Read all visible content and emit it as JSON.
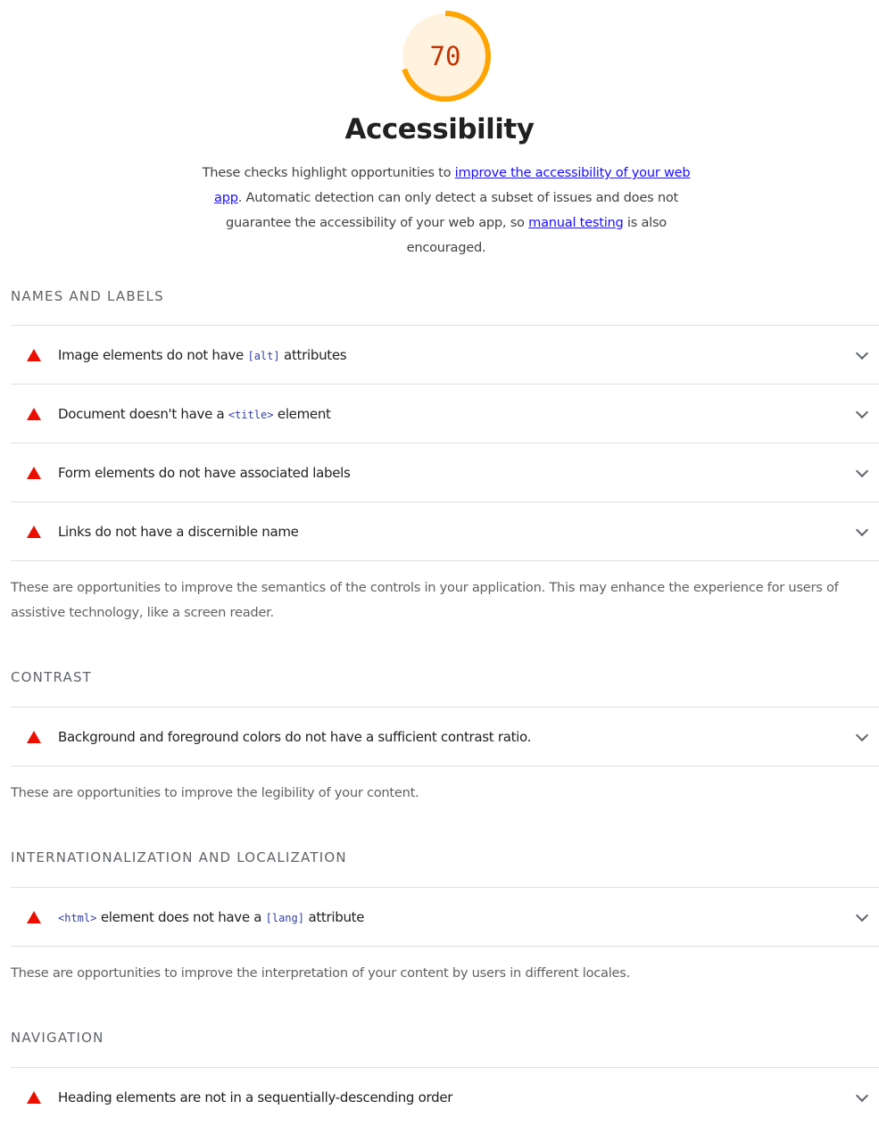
{
  "score": {
    "value": "70",
    "fraction": 0.7,
    "color": "#ffa400",
    "text_color": "#c33300",
    "bg_color": "#fff3e0"
  },
  "header": {
    "title": "Accessibility",
    "desc_part1": "These checks highlight opportunities to ",
    "link1": "improve the accessibility of your web app",
    "desc_part2": ". Automatic detection can only detect a subset of issues and does not guarantee the accessibility of your web app, so ",
    "link2": "manual testing",
    "desc_part3": " is also encouraged."
  },
  "groups": {
    "names": {
      "title": "NAMES AND LABELS",
      "items": [
        {
          "pre": "Image elements do not have ",
          "code": "[alt]",
          "post": " attributes"
        },
        {
          "pre": "Document doesn't have a ",
          "code": "<title>",
          "post": " element"
        },
        {
          "pre": "Form elements do not have associated labels",
          "code": "",
          "post": ""
        },
        {
          "pre": "Links do not have a discernible name",
          "code": "",
          "post": ""
        }
      ],
      "description": "These are opportunities to improve the semantics of the controls in your application. This may enhance the experience for users of assistive technology, like a screen reader."
    },
    "contrast": {
      "title": "CONTRAST",
      "items": [
        {
          "pre": "Background and foreground colors do not have a sufficient contrast ratio.",
          "code": "",
          "post": ""
        }
      ],
      "description": "These are opportunities to improve the legibility of your content."
    },
    "i18n": {
      "title": "INTERNATIONALIZATION AND LOCALIZATION",
      "items": [
        {
          "pre": "",
          "code": "<html>",
          "post": " element does not have a ",
          "code2": "[lang]",
          "post2": " attribute"
        }
      ],
      "description": "These are opportunities to improve the interpretation of your content by users in different locales."
    },
    "navigation": {
      "title": "NAVIGATION",
      "items": [
        {
          "pre": "Heading elements are not in a sequentially-descending order",
          "code": "",
          "post": ""
        }
      ]
    }
  },
  "colors": {
    "fail": "#eb0f00",
    "link": "#1a0dff",
    "code": "#303f9f"
  }
}
